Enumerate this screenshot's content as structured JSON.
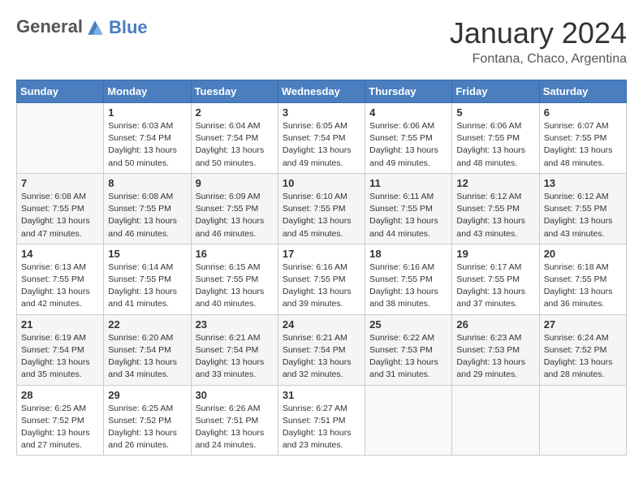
{
  "header": {
    "logo_line1": "General",
    "logo_line2": "Blue",
    "month": "January 2024",
    "location": "Fontana, Chaco, Argentina"
  },
  "columns": [
    "Sunday",
    "Monday",
    "Tuesday",
    "Wednesday",
    "Thursday",
    "Friday",
    "Saturday"
  ],
  "weeks": [
    [
      {
        "day": "",
        "sunrise": "",
        "sunset": "",
        "daylight": ""
      },
      {
        "day": "1",
        "sunrise": "Sunrise: 6:03 AM",
        "sunset": "Sunset: 7:54 PM",
        "daylight": "Daylight: 13 hours and 50 minutes."
      },
      {
        "day": "2",
        "sunrise": "Sunrise: 6:04 AM",
        "sunset": "Sunset: 7:54 PM",
        "daylight": "Daylight: 13 hours and 50 minutes."
      },
      {
        "day": "3",
        "sunrise": "Sunrise: 6:05 AM",
        "sunset": "Sunset: 7:54 PM",
        "daylight": "Daylight: 13 hours and 49 minutes."
      },
      {
        "day": "4",
        "sunrise": "Sunrise: 6:06 AM",
        "sunset": "Sunset: 7:55 PM",
        "daylight": "Daylight: 13 hours and 49 minutes."
      },
      {
        "day": "5",
        "sunrise": "Sunrise: 6:06 AM",
        "sunset": "Sunset: 7:55 PM",
        "daylight": "Daylight: 13 hours and 48 minutes."
      },
      {
        "day": "6",
        "sunrise": "Sunrise: 6:07 AM",
        "sunset": "Sunset: 7:55 PM",
        "daylight": "Daylight: 13 hours and 48 minutes."
      }
    ],
    [
      {
        "day": "7",
        "sunrise": "Sunrise: 6:08 AM",
        "sunset": "Sunset: 7:55 PM",
        "daylight": "Daylight: 13 hours and 47 minutes."
      },
      {
        "day": "8",
        "sunrise": "Sunrise: 6:08 AM",
        "sunset": "Sunset: 7:55 PM",
        "daylight": "Daylight: 13 hours and 46 minutes."
      },
      {
        "day": "9",
        "sunrise": "Sunrise: 6:09 AM",
        "sunset": "Sunset: 7:55 PM",
        "daylight": "Daylight: 13 hours and 46 minutes."
      },
      {
        "day": "10",
        "sunrise": "Sunrise: 6:10 AM",
        "sunset": "Sunset: 7:55 PM",
        "daylight": "Daylight: 13 hours and 45 minutes."
      },
      {
        "day": "11",
        "sunrise": "Sunrise: 6:11 AM",
        "sunset": "Sunset: 7:55 PM",
        "daylight": "Daylight: 13 hours and 44 minutes."
      },
      {
        "day": "12",
        "sunrise": "Sunrise: 6:12 AM",
        "sunset": "Sunset: 7:55 PM",
        "daylight": "Daylight: 13 hours and 43 minutes."
      },
      {
        "day": "13",
        "sunrise": "Sunrise: 6:12 AM",
        "sunset": "Sunset: 7:55 PM",
        "daylight": "Daylight: 13 hours and 43 minutes."
      }
    ],
    [
      {
        "day": "14",
        "sunrise": "Sunrise: 6:13 AM",
        "sunset": "Sunset: 7:55 PM",
        "daylight": "Daylight: 13 hours and 42 minutes."
      },
      {
        "day": "15",
        "sunrise": "Sunrise: 6:14 AM",
        "sunset": "Sunset: 7:55 PM",
        "daylight": "Daylight: 13 hours and 41 minutes."
      },
      {
        "day": "16",
        "sunrise": "Sunrise: 6:15 AM",
        "sunset": "Sunset: 7:55 PM",
        "daylight": "Daylight: 13 hours and 40 minutes."
      },
      {
        "day": "17",
        "sunrise": "Sunrise: 6:16 AM",
        "sunset": "Sunset: 7:55 PM",
        "daylight": "Daylight: 13 hours and 39 minutes."
      },
      {
        "day": "18",
        "sunrise": "Sunrise: 6:16 AM",
        "sunset": "Sunset: 7:55 PM",
        "daylight": "Daylight: 13 hours and 38 minutes."
      },
      {
        "day": "19",
        "sunrise": "Sunrise: 6:17 AM",
        "sunset": "Sunset: 7:55 PM",
        "daylight": "Daylight: 13 hours and 37 minutes."
      },
      {
        "day": "20",
        "sunrise": "Sunrise: 6:18 AM",
        "sunset": "Sunset: 7:55 PM",
        "daylight": "Daylight: 13 hours and 36 minutes."
      }
    ],
    [
      {
        "day": "21",
        "sunrise": "Sunrise: 6:19 AM",
        "sunset": "Sunset: 7:54 PM",
        "daylight": "Daylight: 13 hours and 35 minutes."
      },
      {
        "day": "22",
        "sunrise": "Sunrise: 6:20 AM",
        "sunset": "Sunset: 7:54 PM",
        "daylight": "Daylight: 13 hours and 34 minutes."
      },
      {
        "day": "23",
        "sunrise": "Sunrise: 6:21 AM",
        "sunset": "Sunset: 7:54 PM",
        "daylight": "Daylight: 13 hours and 33 minutes."
      },
      {
        "day": "24",
        "sunrise": "Sunrise: 6:21 AM",
        "sunset": "Sunset: 7:54 PM",
        "daylight": "Daylight: 13 hours and 32 minutes."
      },
      {
        "day": "25",
        "sunrise": "Sunrise: 6:22 AM",
        "sunset": "Sunset: 7:53 PM",
        "daylight": "Daylight: 13 hours and 31 minutes."
      },
      {
        "day": "26",
        "sunrise": "Sunrise: 6:23 AM",
        "sunset": "Sunset: 7:53 PM",
        "daylight": "Daylight: 13 hours and 29 minutes."
      },
      {
        "day": "27",
        "sunrise": "Sunrise: 6:24 AM",
        "sunset": "Sunset: 7:52 PM",
        "daylight": "Daylight: 13 hours and 28 minutes."
      }
    ],
    [
      {
        "day": "28",
        "sunrise": "Sunrise: 6:25 AM",
        "sunset": "Sunset: 7:52 PM",
        "daylight": "Daylight: 13 hours and 27 minutes."
      },
      {
        "day": "29",
        "sunrise": "Sunrise: 6:25 AM",
        "sunset": "Sunset: 7:52 PM",
        "daylight": "Daylight: 13 hours and 26 minutes."
      },
      {
        "day": "30",
        "sunrise": "Sunrise: 6:26 AM",
        "sunset": "Sunset: 7:51 PM",
        "daylight": "Daylight: 13 hours and 24 minutes."
      },
      {
        "day": "31",
        "sunrise": "Sunrise: 6:27 AM",
        "sunset": "Sunset: 7:51 PM",
        "daylight": "Daylight: 13 hours and 23 minutes."
      },
      {
        "day": "",
        "sunrise": "",
        "sunset": "",
        "daylight": ""
      },
      {
        "day": "",
        "sunrise": "",
        "sunset": "",
        "daylight": ""
      },
      {
        "day": "",
        "sunrise": "",
        "sunset": "",
        "daylight": ""
      }
    ]
  ]
}
